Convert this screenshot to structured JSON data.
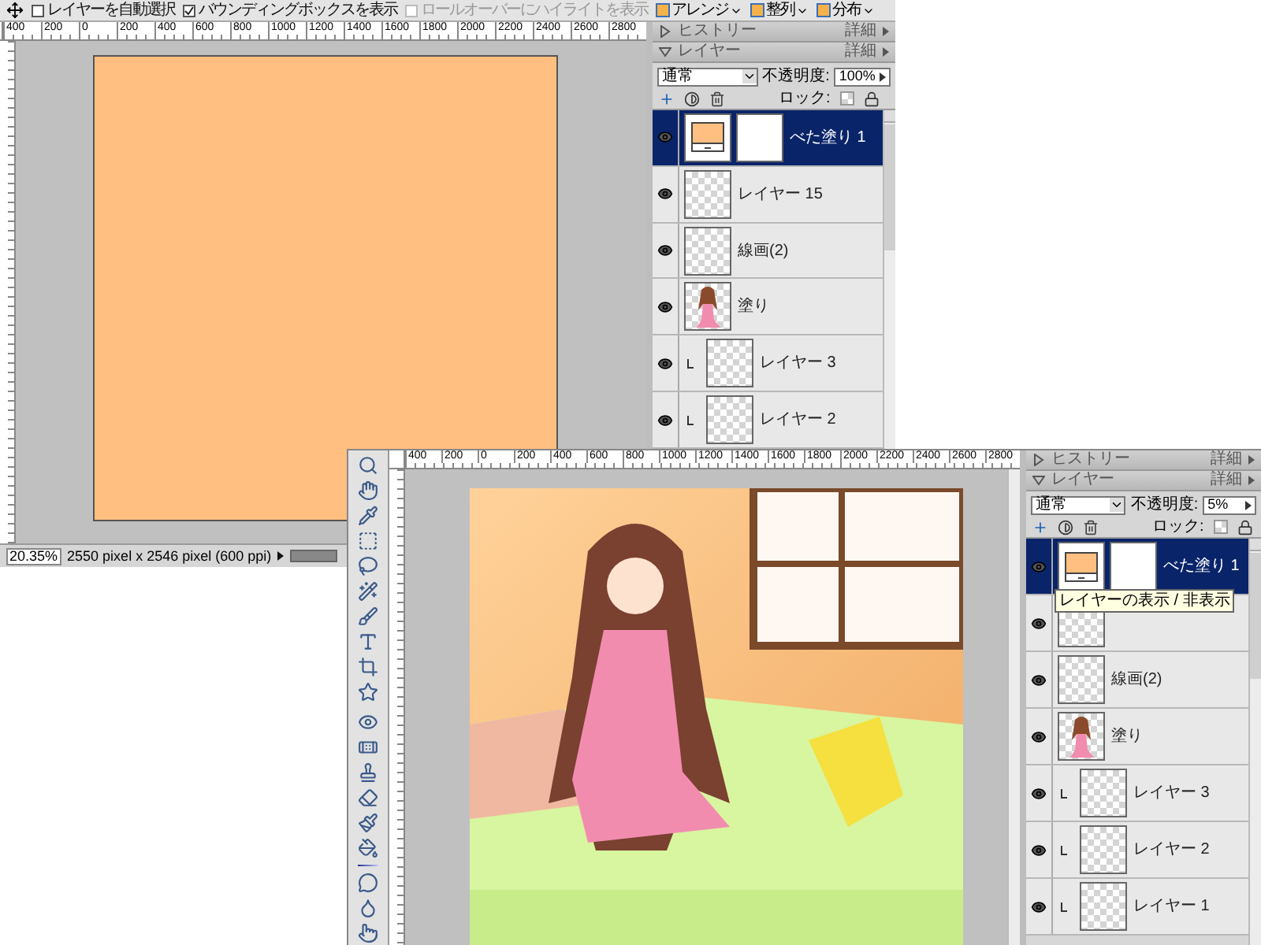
{
  "windows": [
    {
      "toolbar": {
        "options": [
          {
            "label": "レイヤーを自動選択",
            "checked": false,
            "disabled": false
          },
          {
            "label": "バウンディングボックスを表示",
            "checked": true,
            "disabled": false
          },
          {
            "label": "ロールオーバーにハイライトを表示",
            "checked": false,
            "disabled": true
          }
        ],
        "menus": [
          {
            "label": "アレンジ"
          },
          {
            "label": "整列"
          },
          {
            "label": "分布"
          }
        ]
      },
      "ruler_labels": [
        "400",
        "200",
        "0",
        "200",
        "400",
        "600",
        "800",
        "1000",
        "1200",
        "1400",
        "1600",
        "1800",
        "2000",
        "2200",
        "2400",
        "2600",
        "2800"
      ],
      "canvas": {
        "kind": "fill"
      },
      "status_bar": {
        "zoom": "20.35%",
        "info": "2550 pixel x 2546 pixel (600 ppi)"
      },
      "panel": {
        "sections": [
          {
            "title": "ヒストリー",
            "expanded": false,
            "more": "詳細"
          },
          {
            "title": "レイヤー",
            "expanded": true,
            "more": "詳細"
          }
        ],
        "blend_mode": "通常",
        "opacity_label": "不透明度:",
        "opacity": "100%",
        "lock_label": "ロック:",
        "lock_transparency": false,
        "layers": [
          {
            "name": "べた塗り 1",
            "kind": "fill",
            "selected": true,
            "visible": true
          },
          {
            "name": "レイヤー 15",
            "kind": "pixel",
            "selected": false,
            "visible": true
          },
          {
            "name": "線画(2)",
            "kind": "pixel",
            "selected": false,
            "visible": true
          },
          {
            "name": "塗り",
            "kind": "figure",
            "selected": false,
            "visible": true,
            "children": [
              {
                "name": "レイヤー 3",
                "kind": "pixel",
                "selected": false,
                "visible": true
              },
              {
                "name": "レイヤー 2",
                "kind": "pixel",
                "selected": false,
                "visible": true
              }
            ]
          }
        ]
      }
    },
    {
      "ruler_labels": [
        "400",
        "200",
        "0",
        "200",
        "400",
        "600",
        "800",
        "1000",
        "1200",
        "1400",
        "1600",
        "1800",
        "2000",
        "2200",
        "2400",
        "2600",
        "2800"
      ],
      "canvas": {
        "kind": "illustration"
      },
      "panel": {
        "sections": [
          {
            "title": "ヒストリー",
            "expanded": false,
            "more": "詳細"
          },
          {
            "title": "レイヤー",
            "expanded": true,
            "more": "詳細"
          }
        ],
        "blend_mode": "通常",
        "opacity_label": "不透明度:",
        "opacity": "5%",
        "lock_label": "ロック:",
        "lock_transparency": false,
        "tooltip": "レイヤーの表示 / 非表示",
        "layers": [
          {
            "name": "べた塗り 1",
            "kind": "fill",
            "selected": true,
            "visible": true
          },
          {
            "kind": "pixel",
            "selected": false,
            "visible": true
          },
          {
            "name": "線画(2)",
            "kind": "pixel",
            "selected": false,
            "visible": true
          },
          {
            "name": "塗り",
            "kind": "figure",
            "selected": false,
            "visible": true,
            "children": [
              {
                "name": "レイヤー 3",
                "kind": "pixel",
                "selected": false,
                "visible": true
              },
              {
                "name": "レイヤー 2",
                "kind": "pixel",
                "selected": false,
                "visible": true
              },
              {
                "name": "レイヤー 1",
                "kind": "pixel",
                "selected": false,
                "visible": true
              }
            ]
          }
        ]
      }
    }
  ]
}
